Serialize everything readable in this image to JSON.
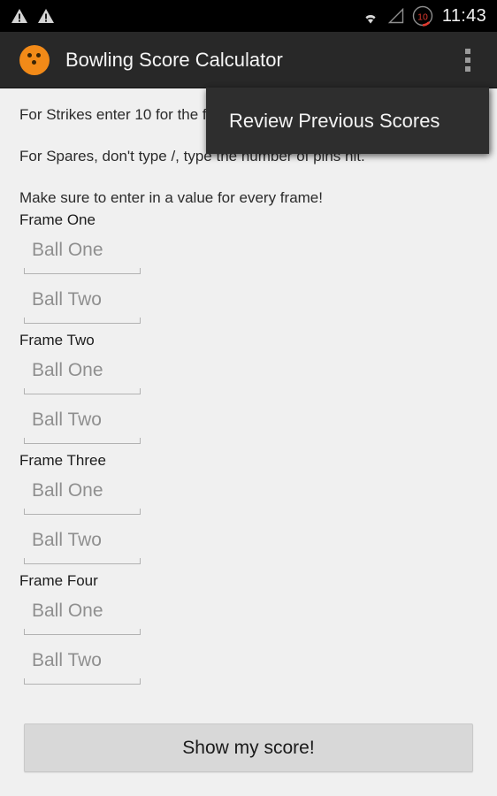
{
  "status_bar": {
    "icons": [
      "warning-triangle-icon",
      "warning-triangle-icon",
      "wifi-icon",
      "cell-signal-icon",
      "battery-circle-icon"
    ],
    "battery_level": "10",
    "clock": "11:43",
    "background_color": "#000000"
  },
  "action_bar": {
    "app_icon": "bowling-ball-icon",
    "app_icon_color": "#f28a18",
    "title": "Bowling Score Calculator",
    "overflow_icon": "overflow-menu-icon",
    "background_color": "#282828"
  },
  "popup_menu": {
    "visible": true,
    "items": [
      {
        "label": "Review Previous Scores"
      }
    ],
    "background_color": "#2e2e2e"
  },
  "content": {
    "background_color": "#f0f0f0",
    "instructions": [
      "For Strikes enter 10 for the first ball and 0 for the second.",
      "For Spares, don't type /, type the number of pins hit.",
      "Make sure to enter in a value for every frame!"
    ],
    "frames": [
      {
        "label": "Frame One",
        "balls": [
          {
            "placeholder": "Ball One",
            "value": ""
          },
          {
            "placeholder": "Ball Two",
            "value": ""
          }
        ]
      },
      {
        "label": "Frame Two",
        "balls": [
          {
            "placeholder": "Ball One",
            "value": ""
          },
          {
            "placeholder": "Ball Two",
            "value": ""
          }
        ]
      },
      {
        "label": "Frame Three",
        "balls": [
          {
            "placeholder": "Ball One",
            "value": ""
          },
          {
            "placeholder": "Ball Two",
            "value": ""
          }
        ]
      },
      {
        "label": "Frame Four",
        "balls": [
          {
            "placeholder": "Ball One",
            "value": ""
          },
          {
            "placeholder": "Ball Two",
            "value": ""
          }
        ]
      }
    ],
    "submit_label": "Show my score!"
  }
}
